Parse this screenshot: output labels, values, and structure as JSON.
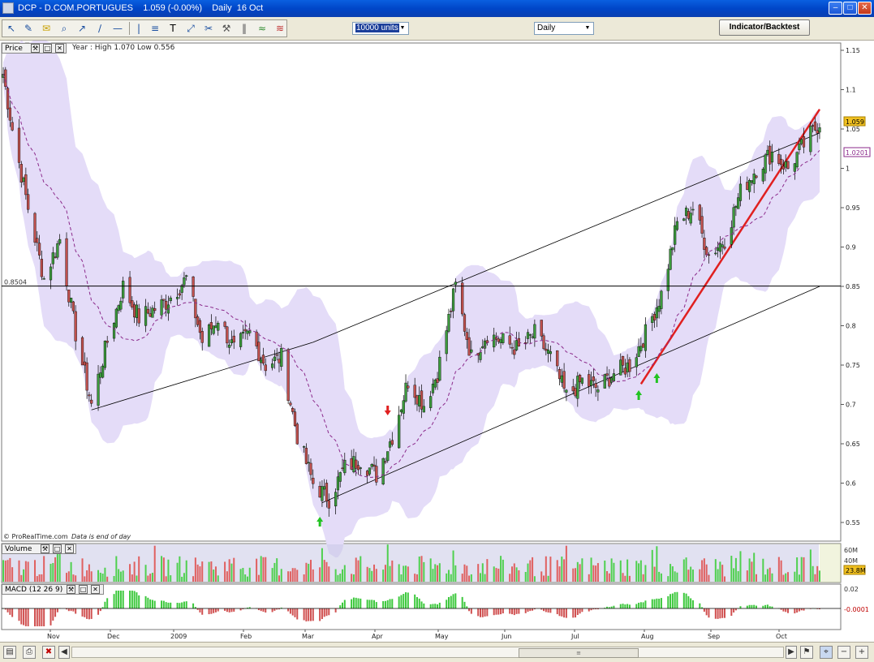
{
  "window": {
    "title": "DCP - D.COM.PORTUGUES    1.059 (-0.00%)    Daily  16 Oct",
    "controls": [
      "minimize-icon",
      "maximize-icon",
      "close-icon"
    ]
  },
  "toolbar": {
    "icons": [
      "pointer-icon",
      "ruler-icon",
      "alarm-bell-icon",
      "zoom-icon",
      "line-draw-icon",
      "trend-line-icon",
      "horizontal-line-icon",
      "vertical-line-icon",
      "fibonacci-icon",
      "text-icon",
      "cross-arrows-icon",
      "scissors-icon",
      "hammer-icon",
      "columns-icon",
      "indicator-icon",
      "backtest-icon"
    ],
    "units_value": "10000 units",
    "period_value": "Daily",
    "indicator_button": "Indicator/Backtest"
  },
  "price_panel": {
    "header_label": "Price",
    "info_text": "Year : High 1.070 Low 0.556",
    "level_label": "0.8504",
    "footer_text": "© ProRealTime.com",
    "footer_note": "Data is end of day",
    "y_ticks": [
      "1.15",
      "1.1",
      "1.05",
      "1",
      "0.95",
      "0.9",
      "0.85",
      "0.8",
      "0.75",
      "0.7",
      "0.65",
      "0.6",
      "0.55"
    ],
    "last_price_badge": "1.059",
    "ma_badge": "1.0201"
  },
  "volume_panel": {
    "header_label": "Volume",
    "y_ticks": [
      "60M",
      "40M"
    ],
    "badge": "23.8M"
  },
  "macd_panel": {
    "header_label": "MACD (12 26 9)",
    "y_ticks": [
      "0.02"
    ],
    "badge": "-0.0001"
  },
  "x_axis_labels": [
    "Nov",
    "Dec",
    "2009",
    "Feb",
    "Mar",
    "Apr",
    "May",
    "Jun",
    "Jul",
    "Aug",
    "Sep",
    "Oct"
  ],
  "colors": {
    "up_candle": "#3c9a3c",
    "down_candle": "#c0504d",
    "bollinger_band": "#e4dcf8",
    "moving_average": "#8b2a8b",
    "trend_line_red": "#e02020",
    "buy_arrow": "#22c322",
    "sell_arrow": "#e02020"
  },
  "chart_data": {
    "type": "candlestick",
    "title": "",
    "subtitle": "",
    "xlabel": "",
    "ylabel": "",
    "y_range": [
      0.55,
      1.15
    ],
    "period": "Nov 2008 - Oct 2009",
    "price_points": [
      [
        "2008-10-20",
        1.12
      ],
      [
        "2008-10-24",
        1.05
      ],
      [
        "2008-10-31",
        0.95
      ],
      [
        "2008-11-07",
        0.86
      ],
      [
        "2008-11-14",
        0.91
      ],
      [
        "2008-11-21",
        0.79
      ],
      [
        "2008-11-28",
        0.7
      ],
      [
        "2008-12-05",
        0.78
      ],
      [
        "2008-12-12",
        0.85
      ],
      [
        "2008-12-19",
        0.81
      ],
      [
        "2008-12-31",
        0.83
      ],
      [
        "2009-01-09",
        0.86
      ],
      [
        "2009-01-16",
        0.78
      ],
      [
        "2009-01-23",
        0.81
      ],
      [
        "2009-01-30",
        0.77
      ],
      [
        "2009-02-06",
        0.79
      ],
      [
        "2009-02-13",
        0.75
      ],
      [
        "2009-02-20",
        0.76
      ],
      [
        "2009-02-27",
        0.66
      ],
      [
        "2009-03-06",
        0.6
      ],
      [
        "2009-03-13",
        0.58
      ],
      [
        "2009-03-20",
        0.62
      ],
      [
        "2009-03-27",
        0.63
      ],
      [
        "2009-04-03",
        0.61
      ],
      [
        "2009-04-10",
        0.66
      ],
      [
        "2009-04-17",
        0.73
      ],
      [
        "2009-04-24",
        0.7
      ],
      [
        "2009-04-30",
        0.74
      ],
      [
        "2009-05-08",
        0.85
      ],
      [
        "2009-05-15",
        0.76
      ],
      [
        "2009-05-22",
        0.79
      ],
      [
        "2009-05-29",
        0.78
      ],
      [
        "2009-06-05",
        0.77
      ],
      [
        "2009-06-12",
        0.79
      ],
      [
        "2009-06-19",
        0.76
      ],
      [
        "2009-06-26",
        0.71
      ],
      [
        "2009-07-03",
        0.73
      ],
      [
        "2009-07-10",
        0.72
      ],
      [
        "2009-07-17",
        0.74
      ],
      [
        "2009-07-24",
        0.75
      ],
      [
        "2009-07-31",
        0.79
      ],
      [
        "2009-08-07",
        0.84
      ],
      [
        "2009-08-14",
        0.93
      ],
      [
        "2009-08-21",
        0.95
      ],
      [
        "2009-08-28",
        0.89
      ],
      [
        "2009-09-04",
        0.91
      ],
      [
        "2009-09-11",
        0.97
      ],
      [
        "2009-09-18",
        1.0
      ],
      [
        "2009-09-25",
        1.02
      ],
      [
        "2009-10-02",
        1.0
      ],
      [
        "2009-10-09",
        1.03
      ],
      [
        "2009-10-16",
        1.059
      ]
    ],
    "horizontal_level": 0.8504,
    "signals": [
      {
        "type": "buy",
        "date": "2009-03-09"
      },
      {
        "type": "sell",
        "date": "2009-04-08"
      },
      {
        "type": "buy",
        "date": "2009-07-28"
      },
      {
        "type": "buy",
        "date": "2009-08-05"
      }
    ],
    "grid": false,
    "legend": "none"
  }
}
